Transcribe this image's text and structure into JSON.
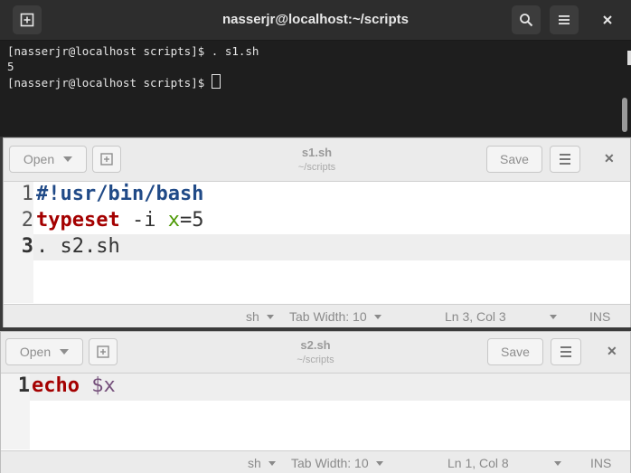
{
  "terminal": {
    "title": "nasserjr@localhost:~/scripts",
    "lines": [
      "[nasserjr@localhost scripts]$ . s1.sh",
      "5",
      "[nasserjr@localhost scripts]$ "
    ],
    "icons": {
      "new_tab": "new-tab-icon",
      "search": "search-icon",
      "menu": "hamburger-menu-icon",
      "close": "close-icon"
    }
  },
  "editor1": {
    "open_label": "Open",
    "title": "s1.sh",
    "subtitle": "~/scripts",
    "save_label": "Save",
    "line_numbers": [
      "1",
      "2",
      "3"
    ],
    "code": {
      "l1": "#!usr/bin/bash",
      "l2_kw": "typeset",
      "l2_opt": " -i ",
      "l2_var": "x",
      "l2_rest": "=5",
      "l3": ". s2.sh"
    },
    "status": {
      "language": "sh",
      "tab_width": "Tab Width: 10",
      "position": "Ln 3, Col 3",
      "mode": "INS"
    }
  },
  "editor2": {
    "open_label": "Open",
    "title": "s2.sh",
    "subtitle": "~/scripts",
    "save_label": "Save",
    "line_numbers": [
      "1"
    ],
    "code": {
      "l1_kw": "echo",
      "l1_space": " ",
      "l1_var": "$x"
    },
    "status": {
      "language": "sh",
      "tab_width": "Tab Width: 10",
      "position": "Ln 1, Col 8",
      "mode": "INS"
    }
  },
  "colors": {
    "keyword": "#a40000",
    "shebang": "#204a87",
    "variable": "#4e9a06",
    "dollar_var": "#75507b",
    "terminal_bg": "#1e1e1e"
  }
}
